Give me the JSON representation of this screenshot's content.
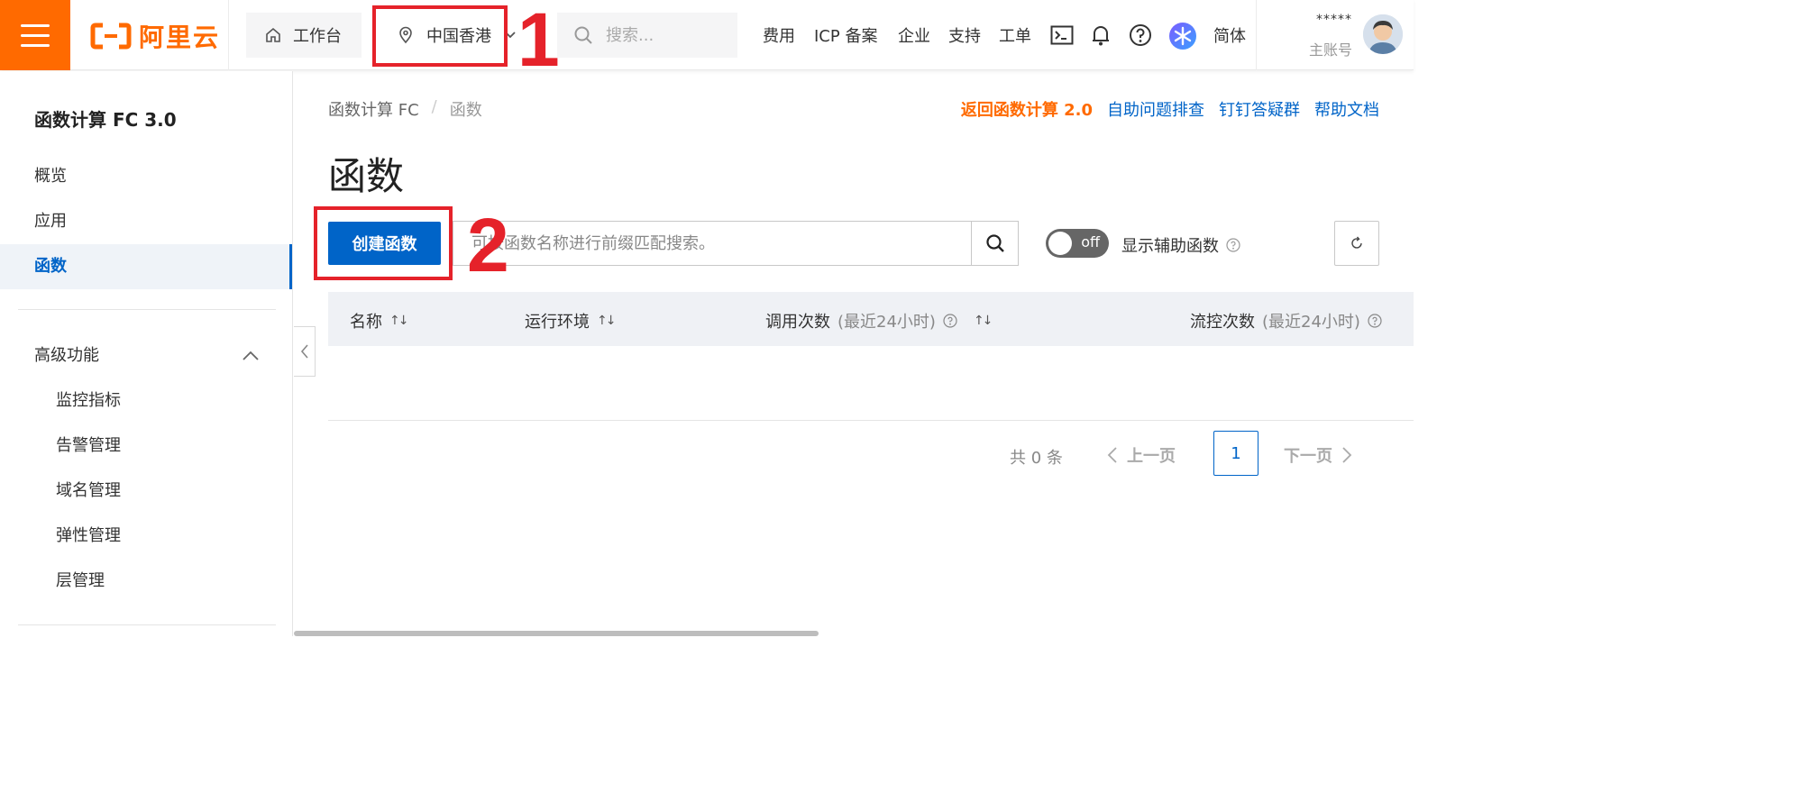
{
  "header": {
    "logo_text": "阿里云",
    "workbench": "工作台",
    "region": "中国香港",
    "search_placeholder": "搜索...",
    "links": [
      "费用",
      "ICP 备案",
      "企业",
      "支持",
      "工单"
    ],
    "language": "简体",
    "user_masked": "*****",
    "user_role": "主账号",
    "icons": [
      "terminal-icon",
      "bell-icon",
      "help-icon",
      "ai-assistant-icon"
    ]
  },
  "sidebar": {
    "product_title": "函数计算 FC 3.0",
    "items": [
      "概览",
      "应用",
      "函数"
    ],
    "active_item": "函数",
    "section_title": "高级功能",
    "sub_items": [
      "监控指标",
      "告警管理",
      "域名管理",
      "弹性管理",
      "层管理"
    ]
  },
  "main": {
    "breadcrumb": [
      "函数计算 FC",
      "函数"
    ],
    "breadcrumb_sep": "/",
    "actions": {
      "back_v2": "返回函数计算 2.0",
      "self_help": "自助问题排查",
      "dingtalk": "钉钉答疑群",
      "docs": "帮助文档"
    },
    "title": "函数",
    "create_button": "创建函数",
    "search_placeholder": "可按函数名称进行前缀匹配搜索。",
    "toggle_label": "off",
    "aux_label": "显示辅助函数",
    "columns": [
      {
        "label": "名称",
        "hint": ""
      },
      {
        "label": "运行环境",
        "hint": ""
      },
      {
        "label": "调用次数",
        "hint": "(最近24小时)"
      },
      {
        "label": "流控次数",
        "hint": "(最近24小时)"
      }
    ],
    "sort_glyph": "↑↓",
    "pagination": {
      "total": "共 0 条",
      "prev": "上一页",
      "current_page": "1",
      "next": "下一页"
    }
  },
  "annotations": [
    "1",
    "2"
  ],
  "colors": {
    "brand_orange": "#ff6a00",
    "primary_blue": "#0064c8",
    "annotation_red": "#e5222a"
  }
}
